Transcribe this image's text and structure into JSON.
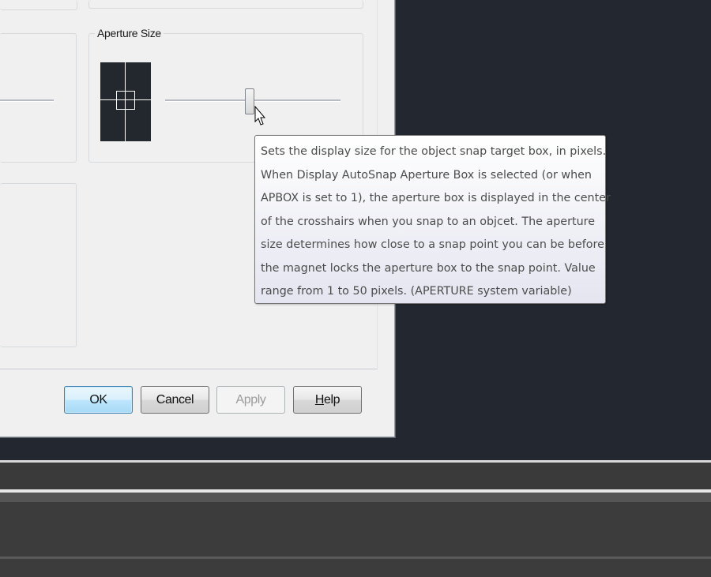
{
  "group": {
    "title": "Aperture Size"
  },
  "slider": {
    "value_fraction": 0.48
  },
  "tooltip": {
    "lines": [
      "Sets the display size for the object snap target box, in pixels.",
      "When Display AutoSnap Aperture Box is selected (or when",
      "APBOX is set to 1), the aperture box is displayed in the center",
      "of the crosshairs when you snap to an objcet. The aperture",
      "size determines how close to a snap point you can be before",
      "the magnet locks the aperture box to the snap point. Value",
      "range from 1 to 50 pixels. (APERTURE system variable)"
    ]
  },
  "buttons": {
    "ok": "OK",
    "cancel": "Cancel",
    "apply": "Apply",
    "help_mnemonic": "H",
    "help_rest": "elp"
  },
  "colors": {
    "canvas": "#232830",
    "dialog": "#f0f0f0",
    "ok_accent": "#3c7fb1"
  }
}
